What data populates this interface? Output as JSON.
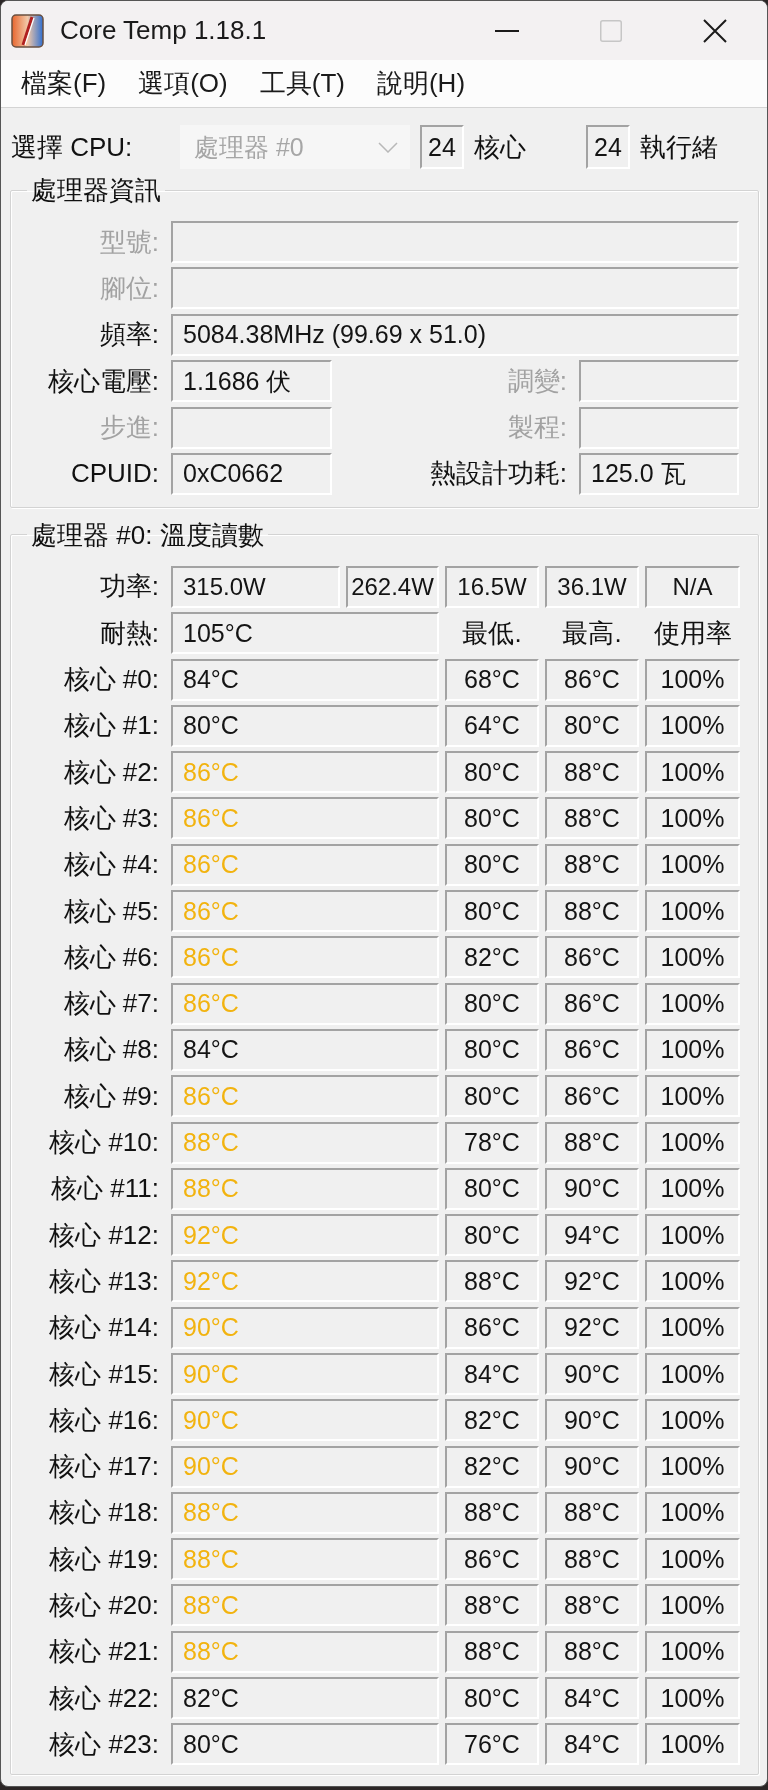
{
  "window": {
    "title": "Core Temp 1.18.1",
    "controls": [
      {
        "kind": "minimize",
        "disabled": false
      },
      {
        "kind": "maximize",
        "disabled": true
      },
      {
        "kind": "close",
        "disabled": false
      }
    ]
  },
  "menu": [
    "檔案(F)",
    "選項(O)",
    "工具(T)",
    "說明(H)"
  ],
  "cpu_select": {
    "label": "選擇 CPU:",
    "value": "處理器 #0",
    "disabled": true,
    "cores": "24",
    "cores_label": "核心",
    "threads": "24",
    "threads_label": "執行緒"
  },
  "processor_info": {
    "title": "處理器資訊",
    "rows": [
      [
        {
          "label": "型號:",
          "disabled": true
        }
      ],
      [
        {
          "label": "腳位:",
          "disabled": true
        }
      ],
      [
        {
          "label": "頻率:",
          "value": "5084.38MHz (99.69 x 51.0)",
          "disabled": false
        }
      ],
      [
        {
          "label": "核心電壓:",
          "value": "1.1686 伏",
          "disabled": false
        },
        {
          "label": "調變:",
          "disabled": true
        }
      ],
      [
        {
          "label": "步進:",
          "disabled": true
        },
        {
          "label": "製程:",
          "disabled": true
        }
      ],
      [
        {
          "label": "CPUID:",
          "value": "0xC0662",
          "disabled": false
        },
        {
          "label": "熱設計功耗:",
          "value": "125.0 瓦",
          "disabled": false
        }
      ]
    ]
  },
  "temperature": {
    "title": "處理器 #0: 溫度讀數",
    "power": {
      "label": "功率:",
      "values": [
        "315.0W",
        "262.4W",
        "16.5W",
        "36.1W",
        "N/A"
      ]
    },
    "tjmax": {
      "label": "耐熱:",
      "value": "105°C"
    },
    "columns": [
      "最低.",
      "最高.",
      "使用率"
    ],
    "cores": [
      {
        "label": "核心 #0:",
        "temp": "84°C",
        "warning": false,
        "min": "68°C",
        "max": "86°C",
        "load": "100%"
      },
      {
        "label": "核心 #1:",
        "temp": "80°C",
        "warning": false,
        "min": "64°C",
        "max": "80°C",
        "load": "100%"
      },
      {
        "label": "核心 #2:",
        "temp": "86°C",
        "warning": true,
        "min": "80°C",
        "max": "88°C",
        "load": "100%"
      },
      {
        "label": "核心 #3:",
        "temp": "86°C",
        "warning": true,
        "min": "80°C",
        "max": "88°C",
        "load": "100%"
      },
      {
        "label": "核心 #4:",
        "temp": "86°C",
        "warning": true,
        "min": "80°C",
        "max": "88°C",
        "load": "100%"
      },
      {
        "label": "核心 #5:",
        "temp": "86°C",
        "warning": true,
        "min": "80°C",
        "max": "88°C",
        "load": "100%"
      },
      {
        "label": "核心 #6:",
        "temp": "86°C",
        "warning": true,
        "min": "82°C",
        "max": "86°C",
        "load": "100%"
      },
      {
        "label": "核心 #7:",
        "temp": "86°C",
        "warning": true,
        "min": "80°C",
        "max": "86°C",
        "load": "100%"
      },
      {
        "label": "核心 #8:",
        "temp": "84°C",
        "warning": false,
        "min": "80°C",
        "max": "86°C",
        "load": "100%"
      },
      {
        "label": "核心 #9:",
        "temp": "86°C",
        "warning": true,
        "min": "80°C",
        "max": "86°C",
        "load": "100%"
      },
      {
        "label": "核心 #10:",
        "temp": "88°C",
        "warning": true,
        "min": "78°C",
        "max": "88°C",
        "load": "100%"
      },
      {
        "label": "核心 #11:",
        "temp": "88°C",
        "warning": true,
        "min": "80°C",
        "max": "90°C",
        "load": "100%"
      },
      {
        "label": "核心 #12:",
        "temp": "92°C",
        "warning": true,
        "min": "80°C",
        "max": "94°C",
        "load": "100%"
      },
      {
        "label": "核心 #13:",
        "temp": "92°C",
        "warning": true,
        "min": "88°C",
        "max": "92°C",
        "load": "100%"
      },
      {
        "label": "核心 #14:",
        "temp": "90°C",
        "warning": true,
        "min": "86°C",
        "max": "92°C",
        "load": "100%"
      },
      {
        "label": "核心 #15:",
        "temp": "90°C",
        "warning": true,
        "min": "84°C",
        "max": "90°C",
        "load": "100%"
      },
      {
        "label": "核心 #16:",
        "temp": "90°C",
        "warning": true,
        "min": "82°C",
        "max": "90°C",
        "load": "100%"
      },
      {
        "label": "核心 #17:",
        "temp": "90°C",
        "warning": true,
        "min": "82°C",
        "max": "90°C",
        "load": "100%"
      },
      {
        "label": "核心 #18:",
        "temp": "88°C",
        "warning": true,
        "min": "88°C",
        "max": "88°C",
        "load": "100%"
      },
      {
        "label": "核心 #19:",
        "temp": "88°C",
        "warning": true,
        "min": "86°C",
        "max": "88°C",
        "load": "100%"
      },
      {
        "label": "核心 #20:",
        "temp": "88°C",
        "warning": true,
        "min": "88°C",
        "max": "88°C",
        "load": "100%"
      },
      {
        "label": "核心 #21:",
        "temp": "88°C",
        "warning": true,
        "min": "88°C",
        "max": "88°C",
        "load": "100%"
      },
      {
        "label": "核心 #22:",
        "temp": "82°C",
        "warning": false,
        "min": "80°C",
        "max": "84°C",
        "load": "100%"
      },
      {
        "label": "核心 #23:",
        "temp": "80°C",
        "warning": false,
        "min": "76°C",
        "max": "84°C",
        "load": "100%"
      }
    ]
  }
}
